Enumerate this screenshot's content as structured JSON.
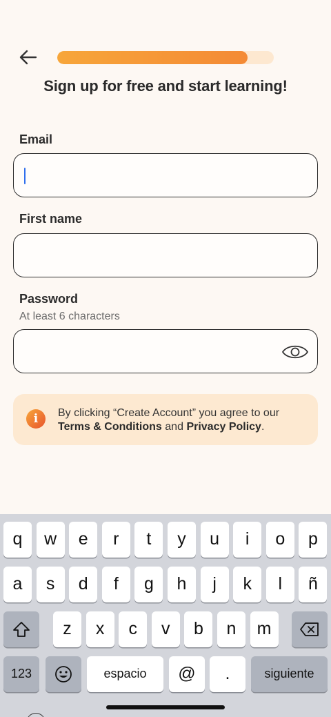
{
  "header": {
    "back_icon": "arrow-left-icon",
    "progress": 0.88,
    "progress_color": "#f48a35",
    "title": "Sign up for free and start learning!"
  },
  "form": {
    "email": {
      "label": "Email",
      "value": "",
      "placeholder": ""
    },
    "first_name": {
      "label": "First name",
      "value": "",
      "placeholder": ""
    },
    "password": {
      "label": "Password",
      "hint": "At least 6 characters",
      "value": "",
      "placeholder": "",
      "toggle_icon": "eye-icon"
    }
  },
  "notice": {
    "icon": "info-icon",
    "icon_glyph": "i",
    "text_prefix": "By clicking “Create Account” you agree to our",
    "terms": "Terms & Conditions",
    "conjunction": "and",
    "privacy": "Privacy Policy",
    "suffix": "."
  },
  "keyboard": {
    "row1": [
      "q",
      "w",
      "e",
      "r",
      "t",
      "y",
      "u",
      "i",
      "o",
      "p"
    ],
    "row2": [
      "a",
      "s",
      "d",
      "f",
      "g",
      "h",
      "j",
      "k",
      "l",
      "ñ"
    ],
    "row3": [
      "z",
      "x",
      "c",
      "v",
      "b",
      "n",
      "m"
    ],
    "shift_icon": "shift-icon",
    "backspace_icon": "backspace-icon",
    "numbers": "123",
    "emoji_icon": "emoji-icon",
    "space": "espacio",
    "at": "@",
    "period": ".",
    "next": "siguiente",
    "globe_icon": "globe-icon"
  }
}
